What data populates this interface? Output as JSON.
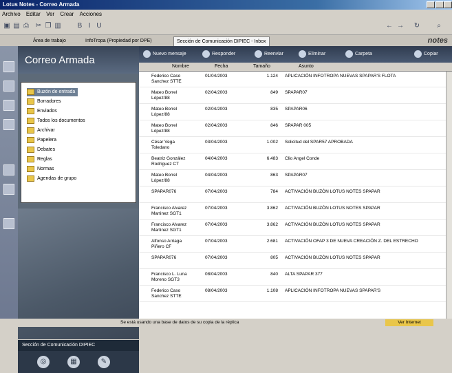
{
  "window": {
    "title": "Lotus Notes - Correo Armada"
  },
  "menu": [
    "Archivo",
    "Editar",
    "Ver",
    "Crear",
    "Acciones"
  ],
  "tabs": [
    {
      "label": "Área de trabajo"
    },
    {
      "label": "InfoTropa (Propiedad por DPE)"
    },
    {
      "label": "Sección de Comunicación DIPIEC - Inbox",
      "active": true
    }
  ],
  "brand": "notes",
  "sidebar": {
    "title": "Correo Armada",
    "folders": [
      {
        "label": "Buzón de entrada",
        "selected": true
      },
      {
        "label": "Borradores"
      },
      {
        "label": "Enviados"
      },
      {
        "label": "Todos los documentos"
      },
      {
        "label": "Archivar"
      },
      {
        "label": "Papelera"
      },
      {
        "label": "Debates"
      },
      {
        "label": "Reglas"
      },
      {
        "label": "Normas"
      },
      {
        "label": "Agendas de grupo"
      }
    ],
    "footer": "Sección de Comunicación DIPIEC"
  },
  "actions": [
    "Nuevo mensaje",
    "Responder",
    "Reenviar",
    "Eliminar",
    "Carpeta",
    "Copiar"
  ],
  "columns": {
    "from": "Nombre",
    "date": "Fecha",
    "size": "Tamaño",
    "subject": "Asunto"
  },
  "messages": [
    {
      "from": "Federico Caso Sanchez STTE",
      "date": "01/04/2003",
      "size": "1.124",
      "subject": "APLICACIÓN INFOTROPA NUEVAS SPAPAR'S FLOTA"
    },
    {
      "from": "Mateo Borrel López/88",
      "date": "02/04/2003",
      "size": "849",
      "subject": "SPAPAR07"
    },
    {
      "from": "Mateo Borrel López/88",
      "date": "02/04/2003",
      "size": "835",
      "subject": "SPAPAR06"
    },
    {
      "from": "Mateo Borrel López/88",
      "date": "02/04/2003",
      "size": "846",
      "subject": "SPAPAR 005"
    },
    {
      "from": "César Vega Toledano",
      "date": "03/04/2003",
      "size": "1.002",
      "subject": "Solicitud del SPAR57 APROBADA"
    },
    {
      "from": "Beatriz González Rodriguez CT",
      "date": "04/04/2003",
      "size": "6.483",
      "subject": "Clio Angel Conde"
    },
    {
      "from": "Mateo Borrel López/88",
      "date": "04/04/2003",
      "size": "863",
      "subject": "SPAPAR07"
    },
    {
      "from": "SPAPAR076",
      "date": "07/04/2003",
      "size": "784",
      "subject": "ACTIVACIÓN BUZÓN LOTUS NOTES SPAPAR"
    },
    {
      "from": "Francisco Alvarez Martinez SGT1",
      "date": "07/04/2003",
      "size": "3.862",
      "subject": "ACTIVACIÓN BUZÓN LOTUS NOTES SPAPAR"
    },
    {
      "from": "Francisco Alvarez Martinez SGT1",
      "date": "07/04/2003",
      "size": "3.862",
      "subject": "ACTIVACIÓN BUZÓN LOTUS NOTES SPAPAR"
    },
    {
      "from": "Alfonso Arriaga Piñero CF",
      "date": "07/04/2003",
      "size": "2.681",
      "subject": "ACTIVACIÓN OFAP 3 DE NUEVA CREACIÓN Z. DEL ESTRECHO"
    },
    {
      "from": "SPAPAR076",
      "date": "07/04/2003",
      "size": "805",
      "subject": "ACTIVACIÓN BUZÓN LOTUS NOTES SPAPAR"
    },
    {
      "from": "Francisco L. Luna Moreno SGT3",
      "date": "08/04/2003",
      "size": "840",
      "subject": "ALTA SPAPAR 377"
    },
    {
      "from": "Federico Caso Sanchez STTE",
      "date": "08/04/2003",
      "size": "1.108",
      "subject": "APLICACIÓN INFOTROPA NUEVAS SPAPAR'S"
    }
  ],
  "status": {
    "message": "Se está usando una base de datos de su copia de la réplica",
    "right": "Ver Internet"
  }
}
